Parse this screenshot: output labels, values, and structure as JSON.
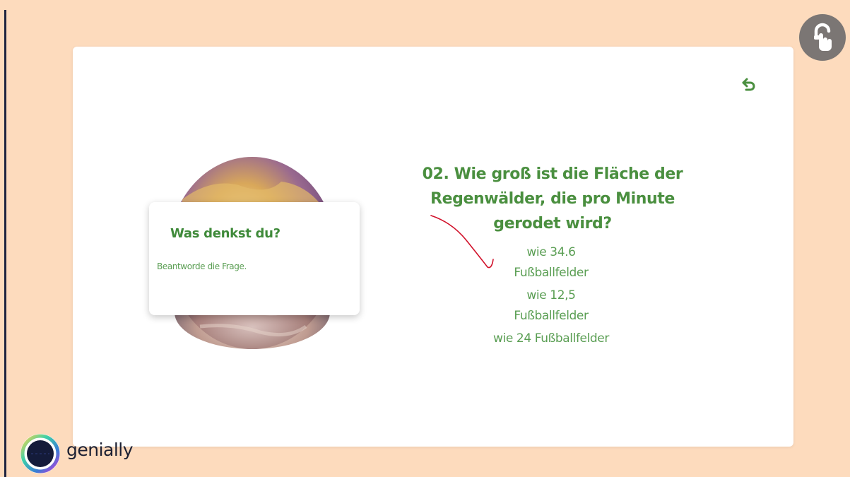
{
  "colors": {
    "background": "#fddbbd",
    "card": "#ffffff",
    "accent_green": "#4a8f3f",
    "light_green": "#5a9e53",
    "lock_button": "#7b7674",
    "scribble": "#d1112a"
  },
  "icons": {
    "back": "undo-arrow-icon",
    "lock": "unlock-hand-icon",
    "logo": "genially-logo-icon"
  },
  "hint_card": {
    "title": "Was denkst du?",
    "text": "Beantworde die Frage."
  },
  "question": {
    "text": "02. Wie groß ist die Fläche der Regenwälder, die pro Minute gerodet wird?"
  },
  "answers": [
    {
      "label": "wie 34.6 Fußballfelder"
    },
    {
      "label": "wie 12,5 Fußballfelder"
    },
    {
      "label": "wie 24 Fußballfelder"
    }
  ],
  "brand": {
    "name": "genially"
  }
}
